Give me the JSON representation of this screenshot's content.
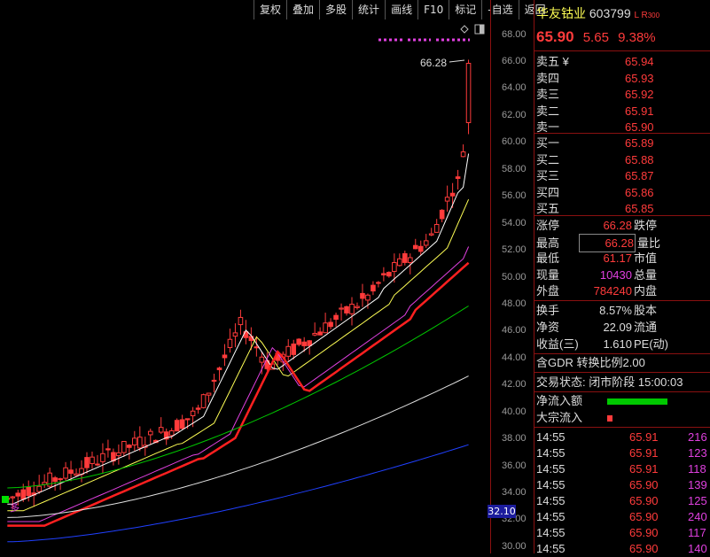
{
  "toolbar": [
    "复权",
    "叠加",
    "多股",
    "统计",
    "画线",
    "F10",
    "标记",
    "-自选",
    "返回"
  ],
  "stock": {
    "name": "华友钴业",
    "code": "603799",
    "tags": "L R",
    "tag300": "300",
    "price": "65.90",
    "change": "5.65",
    "pct": "9.38%"
  },
  "annotation_high": "66.28",
  "chart_marker": "多",
  "y_axis": {
    "labels": [
      "68.00",
      "66.00",
      "64.00",
      "62.00",
      "60.00",
      "58.00",
      "56.00",
      "54.00",
      "52.00",
      "50.00",
      "48.00",
      "46.00",
      "44.00",
      "42.00",
      "40.00",
      "38.00",
      "36.00",
      "34.00",
      "32.00",
      "30.00"
    ],
    "current": "32.10"
  },
  "orderbook": {
    "sell": [
      {
        "label": "卖五 ¥",
        "price": "65.94"
      },
      {
        "label": "卖四",
        "price": "65.93"
      },
      {
        "label": "卖三",
        "price": "65.92"
      },
      {
        "label": "卖二",
        "price": "65.91"
      },
      {
        "label": "卖一",
        "price": "65.90"
      }
    ],
    "buy": [
      {
        "label": "买一",
        "price": "65.89"
      },
      {
        "label": "买二",
        "price": "65.88"
      },
      {
        "label": "买三",
        "price": "65.87"
      },
      {
        "label": "买四",
        "price": "65.86"
      },
      {
        "label": "买五",
        "price": "65.85"
      }
    ]
  },
  "stats1": [
    {
      "label": "涨停",
      "value": "66.28",
      "label2": "跌停"
    },
    {
      "label": "最高",
      "value": "66.28",
      "label2": "量比"
    },
    {
      "label": "最低",
      "value": "61.17",
      "label2": "市值"
    },
    {
      "label": "现量",
      "value": "10430",
      "label2": "总量"
    },
    {
      "label": "外盘",
      "value": "784240",
      "label2": "内盘"
    }
  ],
  "stats2": [
    {
      "label": "换手",
      "value": "8.57%",
      "label2": "股本"
    },
    {
      "label": "净资",
      "value": "22.09",
      "label2": "流通"
    },
    {
      "label": "收益(三)",
      "value": "1.610",
      "label2": "PE(动)"
    }
  ],
  "gdr": "含GDR 转换比例2.00",
  "trade_status": "交易状态: 闭市阶段 15:00:03",
  "flows": [
    {
      "label": "净流入额",
      "color": "#00c800",
      "level": 0.85
    },
    {
      "label": "大宗流入",
      "color": "#ff3b3b",
      "level": 0.05
    }
  ],
  "ticks": [
    {
      "time": "14:55",
      "price": "65.91",
      "vol": "216"
    },
    {
      "time": "14:55",
      "price": "65.91",
      "vol": "123"
    },
    {
      "time": "14:55",
      "price": "65.91",
      "vol": "118"
    },
    {
      "time": "14:55",
      "price": "65.90",
      "vol": "139"
    },
    {
      "time": "14:55",
      "price": "65.90",
      "vol": "125"
    },
    {
      "time": "14:55",
      "price": "65.90",
      "vol": "240"
    },
    {
      "time": "14:55",
      "price": "65.90",
      "vol": "117"
    },
    {
      "time": "14:55",
      "price": "65.90",
      "vol": "140"
    }
  ],
  "colors": {
    "up": "#ff3b3b",
    "ma5": "#ffffff",
    "ma10": "#ffff55",
    "ma20": "#e040e0",
    "ma30": "#ff2020",
    "ma60": "#00c800",
    "ma120": "#e0e0e0",
    "ma250": "#2040ff"
  }
}
